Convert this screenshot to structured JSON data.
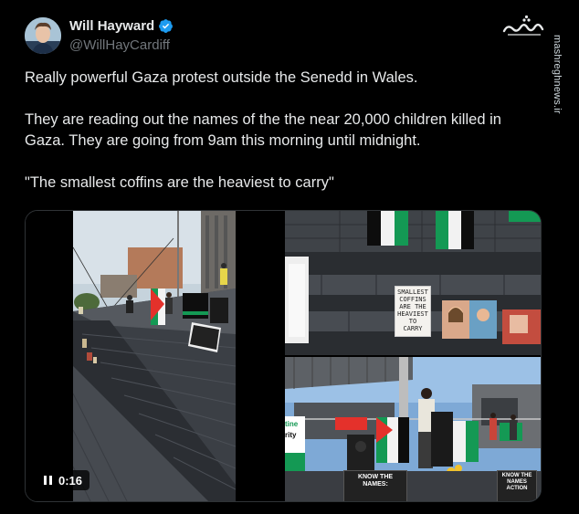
{
  "author": {
    "display_name": "Will Hayward",
    "handle": "@WillHayCardiff",
    "verified": true,
    "verified_color": "#1d9bf0"
  },
  "watermark": {
    "logo_text": "مشرق",
    "site": "mashreghnews.ir"
  },
  "tweet": {
    "line1": "Really powerful Gaza protest outside the Senedd in Wales.",
    "line2": "They are reading out the names of the the near 20,000 children killed in Gaza. They are going from 9am this morning until midnight.",
    "line3": "\"The smallest coffins are the heaviest to carry\""
  },
  "media": {
    "video_time": "0:16",
    "sign_smallest_coffins": [
      "SMALLEST",
      "COFFINS",
      "ARE THE",
      "HEAVIEST",
      "TO",
      "CARRY"
    ],
    "sign_know_the_names": [
      "KNOW THE",
      "NAMES:"
    ],
    "sign_know_the_names_small": [
      "KNOW THE",
      "NAMES",
      "ACTION"
    ],
    "banner_left_partial": [
      "tine",
      "rity",
      "ige"
    ]
  },
  "colors": {
    "background": "#000000",
    "text": "#e7e9ea",
    "muted": "#71767b",
    "flag_green": "#149954",
    "flag_red": "#e4312b"
  }
}
